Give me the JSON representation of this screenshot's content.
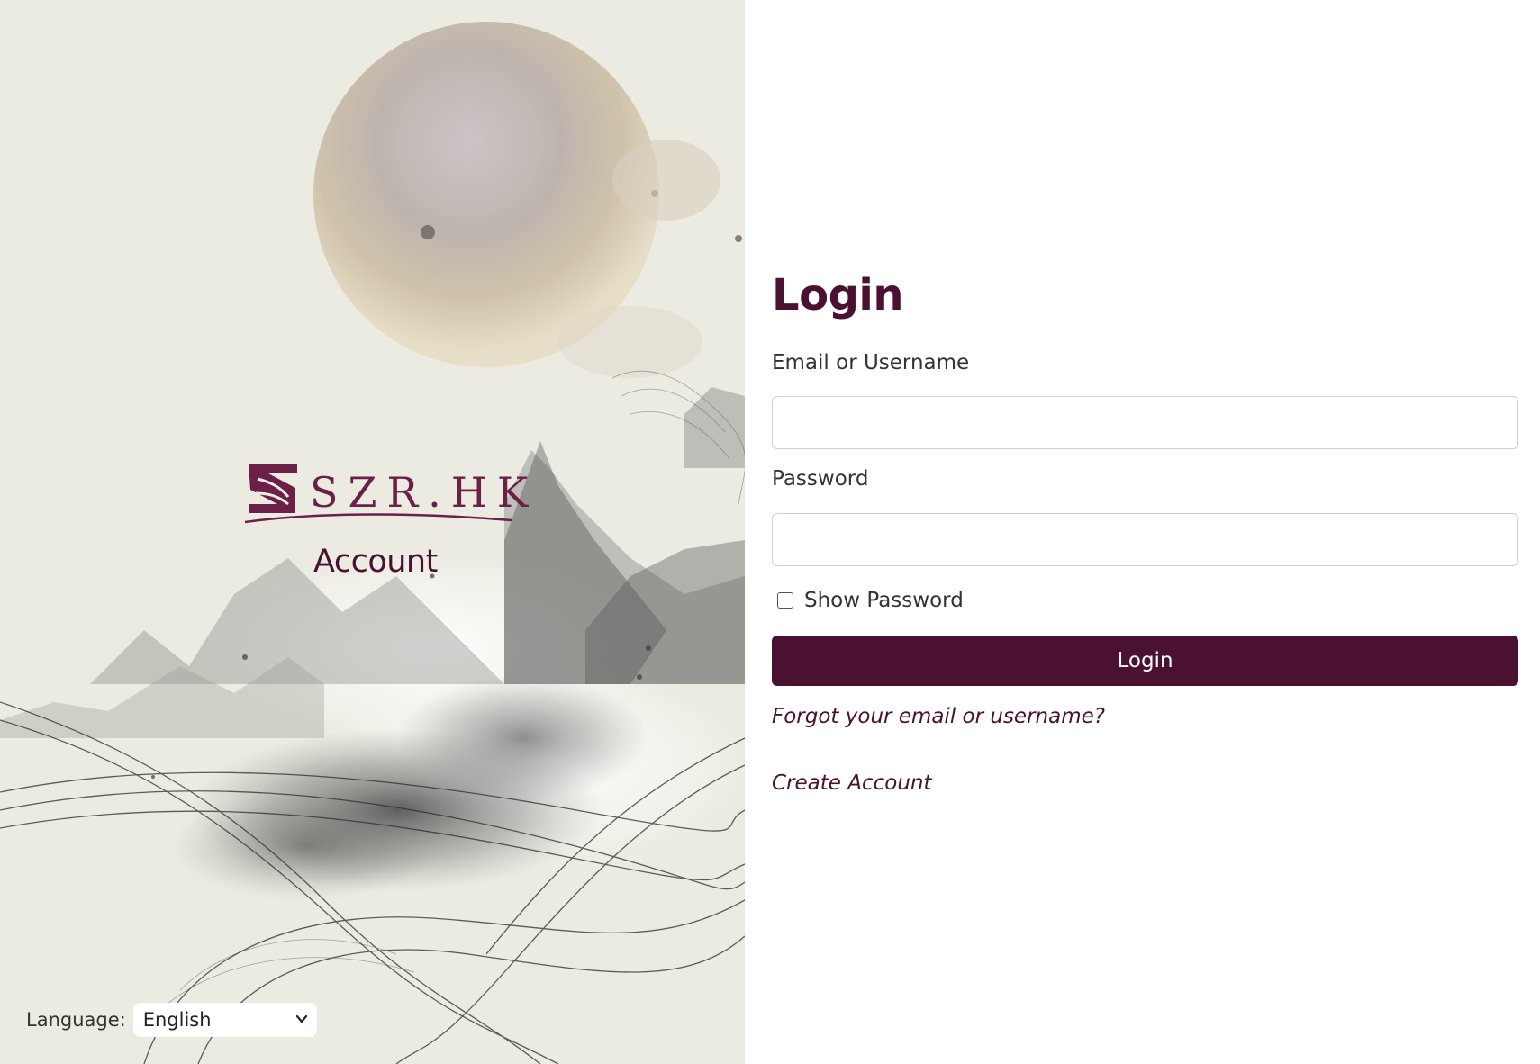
{
  "brand": {
    "name": "SZR.HK",
    "subtitle": "Account",
    "logo_color": "#6b2047"
  },
  "language": {
    "label": "Language:",
    "selected": "English"
  },
  "login": {
    "title": "Login",
    "email_label": "Email or Username",
    "email_value": "",
    "password_label": "Password",
    "password_value": "",
    "show_password_label": "Show Password",
    "show_password_checked": false,
    "submit_label": "Login",
    "forgot_link": "Forgot your email or username?",
    "create_link": "Create Account"
  },
  "colors": {
    "accent": "#4a1230",
    "panel_bg": "#ecebe2"
  }
}
